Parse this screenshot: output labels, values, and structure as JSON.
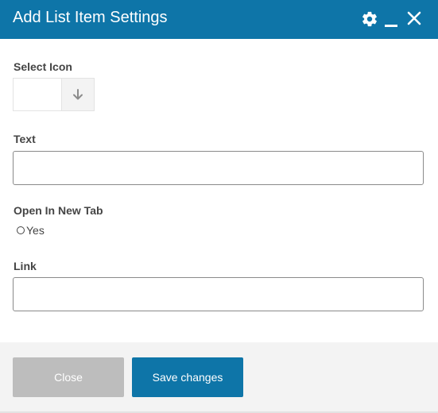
{
  "dialog": {
    "title": "Add List Item Settings",
    "icons": {
      "settings": "gear-icon",
      "minimize": "minimize-icon",
      "close": "close-icon"
    }
  },
  "form": {
    "select_icon": {
      "label": "Select Icon",
      "dropdown_icon": "arrow-down-icon"
    },
    "text": {
      "label": "Text",
      "value": "",
      "placeholder": ""
    },
    "open_in_new_tab": {
      "label": "Open In New Tab",
      "option_label": "Yes",
      "checked": false
    },
    "link": {
      "label": "Link",
      "value": "",
      "placeholder": ""
    }
  },
  "footer": {
    "close_label": "Close",
    "save_label": "Save changes"
  },
  "colors": {
    "header": "#0e75a8",
    "primary_button": "#0e75a8",
    "disabled_button": "#bdbdbd",
    "footer_bg": "#f3f3f3"
  }
}
